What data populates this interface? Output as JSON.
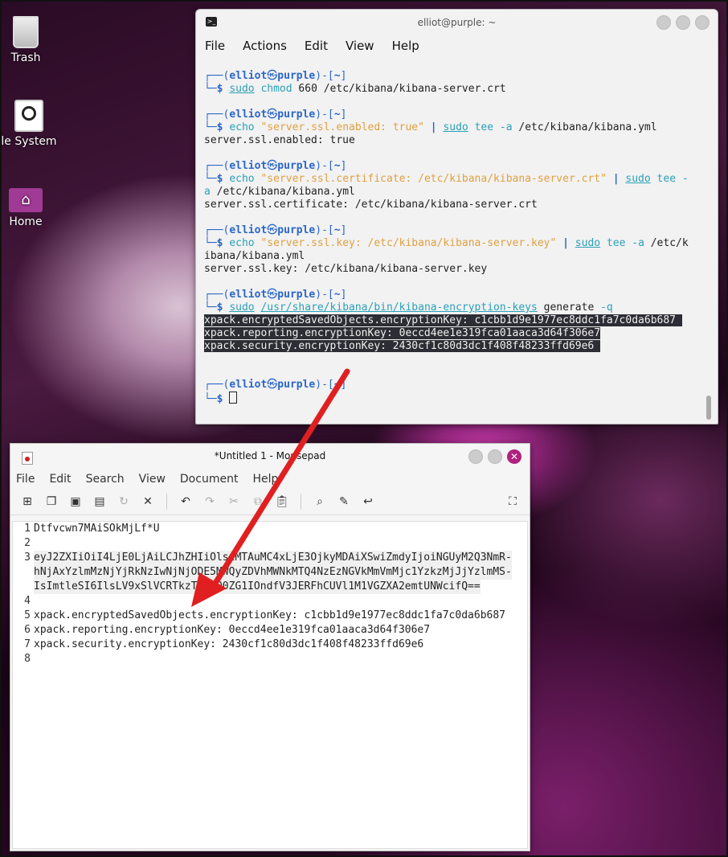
{
  "desktop": {
    "icons": [
      {
        "label": "Trash",
        "icon": "trash-icon"
      },
      {
        "label": "le System",
        "icon": "disk-icon"
      },
      {
        "label": "Home",
        "icon": "home-folder-icon"
      }
    ]
  },
  "terminal": {
    "title": "elliot@purple: ~",
    "menu": [
      "File",
      "Actions",
      "Edit",
      "View",
      "Help"
    ],
    "prompt": {
      "corner_top": "┌──(",
      "user": "elliot",
      "at": "㉿",
      "host": "purple",
      "mid": ")-[",
      "path": "~",
      "end": "]",
      "corner_bottom": "└─",
      "dollar": "$"
    },
    "blocks": [
      {
        "cmd": [
          [
            "cmdkey",
            "sudo"
          ],
          [
            "plain",
            " "
          ],
          [
            "cmdname",
            "chmod"
          ],
          [
            "plain",
            " 660 /etc/kibana/kibana-server.crt"
          ]
        ],
        "out": []
      },
      {
        "cmd": [
          [
            "cmdname",
            "echo"
          ],
          [
            "plain",
            " "
          ],
          [
            "str",
            "\"server.ssl.enabled: true\""
          ],
          [
            "plain",
            " "
          ],
          [
            "pipe",
            "|"
          ],
          [
            "plain",
            " "
          ],
          [
            "cmdkey",
            "sudo"
          ],
          [
            "plain",
            " "
          ],
          [
            "cmdname",
            "tee"
          ],
          [
            "plain",
            " "
          ],
          [
            "cmdname",
            "-a"
          ],
          [
            "plain",
            " /etc/kibana/kibana.yml"
          ]
        ],
        "out": [
          "server.ssl.enabled: true"
        ]
      },
      {
        "cmd": [
          [
            "cmdname",
            "echo"
          ],
          [
            "plain",
            " "
          ],
          [
            "str",
            "\"server.ssl.certificate: /etc/kibana/kibana-server.crt\""
          ],
          [
            "plain",
            " "
          ],
          [
            "pipe",
            "|"
          ],
          [
            "plain",
            " "
          ],
          [
            "cmdkey",
            "sudo"
          ],
          [
            "plain",
            " "
          ],
          [
            "cmdname",
            "tee"
          ],
          [
            "plain",
            " "
          ],
          [
            "cmdname",
            "-"
          ]
        ],
        "wrap": [
          [
            "cmdname",
            "a"
          ],
          [
            "plain",
            " /etc/kibana/kibana.yml"
          ]
        ],
        "out": [
          "server.ssl.certificate: /etc/kibana/kibana-server.crt"
        ]
      },
      {
        "cmd": [
          [
            "cmdname",
            "echo"
          ],
          [
            "plain",
            " "
          ],
          [
            "str",
            "\"server.ssl.key: /etc/kibana/kibana-server.key\""
          ],
          [
            "plain",
            " "
          ],
          [
            "pipe",
            "|"
          ],
          [
            "plain",
            " "
          ],
          [
            "cmdkey",
            "sudo"
          ],
          [
            "plain",
            " "
          ],
          [
            "cmdname",
            "tee"
          ],
          [
            "plain",
            " "
          ],
          [
            "cmdname",
            "-a"
          ],
          [
            "plain",
            " /etc/k"
          ]
        ],
        "wrap": [
          [
            "plain",
            "ibana/kibana.yml"
          ]
        ],
        "out": [
          "server.ssl.key: /etc/kibana/kibana-server.key"
        ]
      },
      {
        "cmd": [
          [
            "cmdkey",
            "sudo"
          ],
          [
            "plain",
            " "
          ],
          [
            "cmdkey",
            "/usr/share/kibana/bin/kibana-encryption-keys"
          ],
          [
            "plain",
            " generate "
          ],
          [
            "cmdname",
            "-q"
          ]
        ],
        "out_hl": [
          "xpack.encryptedSavedObjects.encryptionKey: c1cbb1d9e1977ec8ddc1fa7c0da6b687 ",
          "xpack.reporting.encryptionKey: 0eccd4ee1e319fca01aaca3d64f306e7",
          "xpack.security.encryptionKey: 2430cf1c80d3dc1f408f48233ffd69e6 "
        ]
      }
    ]
  },
  "mousepad": {
    "title": "*Untitled 1 - Mousepad",
    "menu": [
      "File",
      "Edit",
      "Search",
      "View",
      "Document",
      "Help"
    ],
    "toolbar": [
      "new-icon",
      "new-window-icon",
      "save-icon",
      "save-as-icon",
      "reload-icon",
      "close-icon",
      "undo-icon",
      "redo-icon",
      "cut-icon",
      "copy-icon",
      "paste-icon",
      "find-icon",
      "replace-icon",
      "goto-icon",
      "fullscreen-icon"
    ],
    "lines": [
      {
        "n": "1",
        "text": "Dtfvcwn7MAiSOkMjLf*U"
      },
      {
        "n": "2",
        "text": ""
      },
      {
        "n": "3",
        "text": "eyJ2ZXIiOiI4LjE0LjAiLCJhZHIiOlsiMTAuMC4xLjE3OjkyMDAiXSwiZmdyIjoiNGUyM2Q3NmR-",
        "cont": [
          "hNjAxYzlmMzNjYjRkNzIwNjNjODE5MWQyZDVhMWNkMTQ4NzEzNGVkMmVmMjc1YzkzMjJjYzlmMS-",
          "IsImtleSI6IlsLV9xSlVCRTkzT2SDQ0ZG1IOndfV3JERFhCUVl1M1VGZXA2emtUNWcifQ=="
        ]
      },
      {
        "n": "4",
        "text": ""
      },
      {
        "n": "5",
        "text": "xpack.encryptedSavedObjects.encryptionKey: c1cbb1d9e1977ec8ddc1fa7c0da6b687"
      },
      {
        "n": "6",
        "text": "xpack.reporting.encryptionKey: 0eccd4ee1e319fca01aaca3d64f306e7"
      },
      {
        "n": "7",
        "text": "xpack.security.encryptionKey: 2430cf1c80d3dc1f408f48233ffd69e6"
      },
      {
        "n": "8",
        "text": ""
      }
    ]
  },
  "colors": {
    "arrow": "#e02020",
    "accent": "#b0207f",
    "prompt": "#2a66c8"
  }
}
